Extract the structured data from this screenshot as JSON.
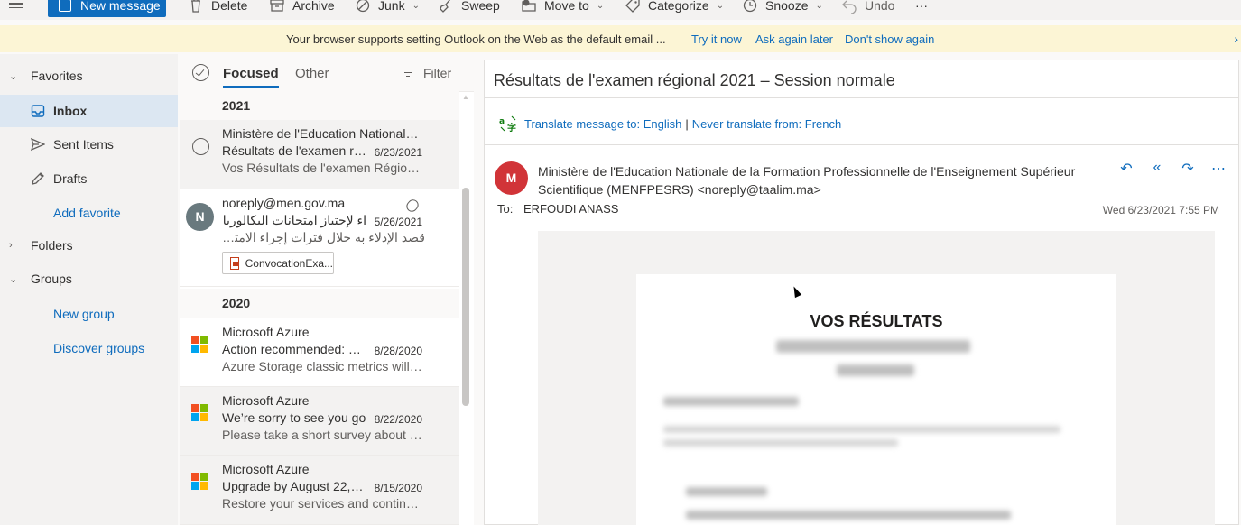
{
  "toolbar": {
    "new_message": "New message",
    "delete": "Delete",
    "archive": "Archive",
    "junk": "Junk",
    "sweep": "Sweep",
    "move_to": "Move to",
    "categorize": "Categorize",
    "snooze": "Snooze",
    "undo": "Undo",
    "more": "···"
  },
  "banner": {
    "message": "Your browser supports setting Outlook on the Web as the default email ...",
    "try_it": "Try it now",
    "ask_later": "Ask again later",
    "dont_show": "Don't show again"
  },
  "nav": {
    "favorites": "Favorites",
    "inbox": "Inbox",
    "sent": "Sent Items",
    "drafts": "Drafts",
    "add_favorite": "Add favorite",
    "folders": "Folders",
    "groups": "Groups",
    "new_group": "New group",
    "discover_groups": "Discover groups"
  },
  "list": {
    "tab_focused": "Focused",
    "tab_other": "Other",
    "filter": "Filter",
    "groups": [
      {
        "label": "2021"
      },
      {
        "label": "2020"
      }
    ],
    "messages": [
      {
        "sender": "Ministère de l'Education Nationale d...",
        "subject": "Résultats de l'examen ré...",
        "date": "6/23/2021",
        "preview": "Vos Résultats de l'examen Régional ..."
      },
      {
        "sender": "noreply@men.gov.ma",
        "subject": "اء لإجتياز امتحانات البكالوريا",
        "date": "5/26/2021",
        "preview": "قصد الإدلاء به خلال فترات إجراء الامتحان...",
        "attachment": "ConvocationExa...",
        "avatar": "N"
      },
      {
        "sender": "Microsoft Azure",
        "subject": "Action recommended: Tr...",
        "date": "8/28/2020",
        "preview": "Azure Storage classic metrics will be ..."
      },
      {
        "sender": "Microsoft Azure",
        "subject": "We’re sorry to see you go",
        "date": "8/22/2020",
        "preview": "Please take a short survey about you..."
      },
      {
        "sender": "Microsoft Azure",
        "subject": "Upgrade by August 22, 2...",
        "date": "8/15/2020",
        "preview": "Restore your services and continue ..."
      }
    ]
  },
  "reading": {
    "subject": "Résultats de l'examen régional 2021 – Session normale",
    "translate": "Translate message to: English",
    "separator": "|",
    "never_translate": "Never translate from: French",
    "avatar": "M",
    "from": "Ministère de l'Education Nationale de la Formation Professionnelle de l'Enseignement Supérieur Scientifique (MENFPESRS) <noreply@taalim.ma>",
    "to_label": "To:",
    "to": "ERFOUDI ANASS",
    "date": "Wed 6/23/2021 7:55 PM",
    "body_heading": "VOS RÉSULTATS"
  },
  "colors": {
    "accent": "#0f6cbd",
    "banner_bg": "#fcf5d5",
    "avatar_m": "#d13438",
    "avatar_n": "#69797e"
  },
  "icons": [
    "hamburger-icon",
    "compose-icon",
    "trash-icon",
    "archive-icon",
    "junk-icon",
    "sweep-icon",
    "move-icon",
    "tag-icon",
    "clock-icon",
    "undo-icon",
    "inbox-icon",
    "send-icon",
    "pencil-icon",
    "paperclip-icon",
    "microsoft-logo-icon",
    "translate-icon",
    "reply-icon",
    "reply-all-icon",
    "forward-icon",
    "more-icon"
  ]
}
